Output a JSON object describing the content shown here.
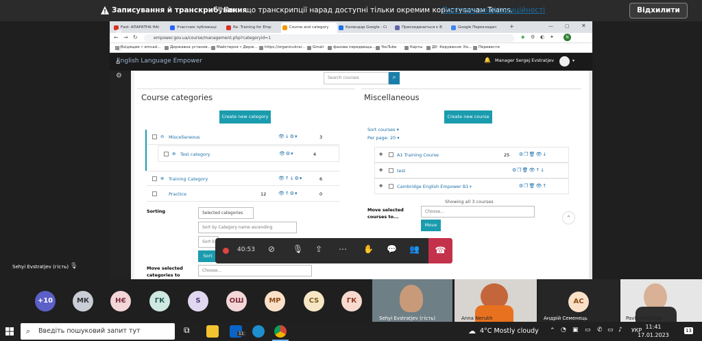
{
  "teams_banner": {
    "title": "Записування й транскрибування",
    "message": "Поки що транскрипції нарад доступні тільки окремим користувачам Teams.",
    "policy_link": "Політика конфіденційності",
    "dismiss_label": "Відхилити"
  },
  "browser": {
    "tabs": [
      {
        "label": "Fwd: АПАРАТНА НАі",
        "color": "#d93025"
      },
      {
        "label": "Участник публикаці",
        "color": "#2962ff"
      },
      {
        "label": "Re: Training for Emp",
        "color": "#d93025"
      },
      {
        "label": "Course and category",
        "color": "#f29900"
      },
      {
        "label": "Календар Google - Ci",
        "color": "#1a73e8"
      },
      {
        "label": "Присоединиться к В",
        "color": "#6264a7"
      },
      {
        "label": "Google Перекладач",
        "color": "#4285f4"
      }
    ],
    "url": "empower.gov.ua/course/management.php?categoryid=1",
    "bookmarks": [
      "Вхідящие • emcad...",
      "Державна установ...",
      "Майстерня • Держ...",
      "https://organicukrai...",
      "Gmail",
      "фахова передвища...",
      "YouTube",
      "Карты",
      "ДУ: Керування: Ко...",
      "Перевести"
    ]
  },
  "moodle": {
    "brand": "English Language Empower",
    "user_name": "Manager Sergej Evstratjev",
    "search_placeholder": "Search courses",
    "left_heading": "Course categories",
    "create_category_label": "Create new category",
    "categories": [
      {
        "name": "Miscellaneous",
        "count": "3"
      },
      {
        "name": "Test category",
        "count": "4"
      },
      {
        "name": "Training Category",
        "count": "6"
      },
      {
        "name": "Practice",
        "subcount": "12",
        "count": "0"
      }
    ],
    "sorting_label": "Sorting",
    "selected_categories": "Selected categories",
    "sort_option": "Sort by Category name ascending",
    "sort_option_2": "Sort b",
    "sort_button": "Sort",
    "move_selected_categories": "Move selected categories to",
    "choose_placeholder": "Choose...",
    "right_heading": "Miscellaneous",
    "create_course_label": "Create new course",
    "sort_courses": "Sort courses",
    "per_page": "Per page: 20",
    "courses": [
      {
        "name": "A1 Training Course",
        "count": "25"
      },
      {
        "name": "test",
        "count": ""
      },
      {
        "name": "Cambridge English Empower B1+",
        "count": ""
      }
    ],
    "showing": "Showing all 3 courses",
    "move_selected_courses": "Move selected courses to...",
    "choose_course_placeholder": "Choose...",
    "move_button": "Move"
  },
  "meeting": {
    "timer": "40:53",
    "presenter_name": "Sehyi Evstratjev (гість)"
  },
  "participants": {
    "initials": [
      {
        "label": "+10",
        "bg": "#5b5fc7",
        "fg": "#ffffff"
      },
      {
        "label": "МК",
        "bg": "#c8cdd6",
        "fg": "#333333"
      },
      {
        "label": "НЄ",
        "bg": "#f3d6d8",
        "fg": "#7a2a36"
      },
      {
        "label": "ГК",
        "bg": "#cfe8e2",
        "fg": "#245c52"
      },
      {
        "label": "S",
        "bg": "#e0d7f0",
        "fg": "#4b3a7a"
      },
      {
        "label": "ОШ",
        "bg": "#f3d6d8",
        "fg": "#7a2a36"
      },
      {
        "label": "МР",
        "bg": "#fbe0c8",
        "fg": "#8a4a14"
      },
      {
        "label": "CS",
        "bg": "#f6e6c6",
        "fg": "#7a5a14"
      },
      {
        "label": "ГК",
        "bg": "#f7d9cf",
        "fg": "#8a3a22"
      }
    ],
    "video_names": [
      "Sehyi Evstratjev (гість)",
      "Anna Nerukh",
      "Андрій Семенець",
      "Pavlo Molochko"
    ],
    "semenets_initials": "АС"
  },
  "taskbar": {
    "search_placeholder": "Введіть пошуковий запит тут",
    "weather": "4°C  Mostly cloudy",
    "lang": "УКР",
    "time": "11:41",
    "date": "17.01.2023",
    "notifications": "13",
    "mail_badge": "11"
  }
}
